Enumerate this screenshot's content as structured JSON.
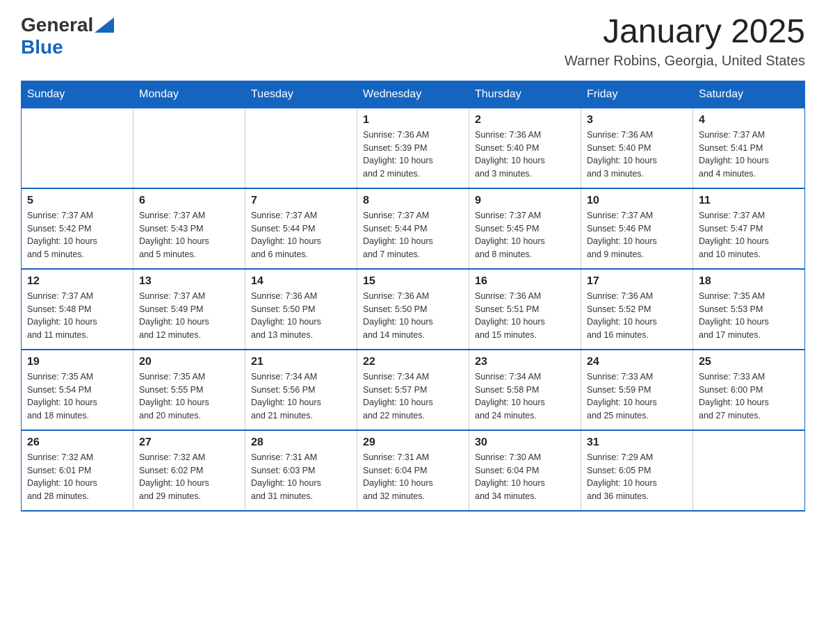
{
  "header": {
    "logo_general": "General",
    "logo_blue": "Blue",
    "month_title": "January 2025",
    "location": "Warner Robins, Georgia, United States"
  },
  "days_of_week": [
    "Sunday",
    "Monday",
    "Tuesday",
    "Wednesday",
    "Thursday",
    "Friday",
    "Saturday"
  ],
  "weeks": [
    [
      {
        "day": "",
        "info": ""
      },
      {
        "day": "",
        "info": ""
      },
      {
        "day": "",
        "info": ""
      },
      {
        "day": "1",
        "info": "Sunrise: 7:36 AM\nSunset: 5:39 PM\nDaylight: 10 hours\nand 2 minutes."
      },
      {
        "day": "2",
        "info": "Sunrise: 7:36 AM\nSunset: 5:40 PM\nDaylight: 10 hours\nand 3 minutes."
      },
      {
        "day": "3",
        "info": "Sunrise: 7:36 AM\nSunset: 5:40 PM\nDaylight: 10 hours\nand 3 minutes."
      },
      {
        "day": "4",
        "info": "Sunrise: 7:37 AM\nSunset: 5:41 PM\nDaylight: 10 hours\nand 4 minutes."
      }
    ],
    [
      {
        "day": "5",
        "info": "Sunrise: 7:37 AM\nSunset: 5:42 PM\nDaylight: 10 hours\nand 5 minutes."
      },
      {
        "day": "6",
        "info": "Sunrise: 7:37 AM\nSunset: 5:43 PM\nDaylight: 10 hours\nand 5 minutes."
      },
      {
        "day": "7",
        "info": "Sunrise: 7:37 AM\nSunset: 5:44 PM\nDaylight: 10 hours\nand 6 minutes."
      },
      {
        "day": "8",
        "info": "Sunrise: 7:37 AM\nSunset: 5:44 PM\nDaylight: 10 hours\nand 7 minutes."
      },
      {
        "day": "9",
        "info": "Sunrise: 7:37 AM\nSunset: 5:45 PM\nDaylight: 10 hours\nand 8 minutes."
      },
      {
        "day": "10",
        "info": "Sunrise: 7:37 AM\nSunset: 5:46 PM\nDaylight: 10 hours\nand 9 minutes."
      },
      {
        "day": "11",
        "info": "Sunrise: 7:37 AM\nSunset: 5:47 PM\nDaylight: 10 hours\nand 10 minutes."
      }
    ],
    [
      {
        "day": "12",
        "info": "Sunrise: 7:37 AM\nSunset: 5:48 PM\nDaylight: 10 hours\nand 11 minutes."
      },
      {
        "day": "13",
        "info": "Sunrise: 7:37 AM\nSunset: 5:49 PM\nDaylight: 10 hours\nand 12 minutes."
      },
      {
        "day": "14",
        "info": "Sunrise: 7:36 AM\nSunset: 5:50 PM\nDaylight: 10 hours\nand 13 minutes."
      },
      {
        "day": "15",
        "info": "Sunrise: 7:36 AM\nSunset: 5:50 PM\nDaylight: 10 hours\nand 14 minutes."
      },
      {
        "day": "16",
        "info": "Sunrise: 7:36 AM\nSunset: 5:51 PM\nDaylight: 10 hours\nand 15 minutes."
      },
      {
        "day": "17",
        "info": "Sunrise: 7:36 AM\nSunset: 5:52 PM\nDaylight: 10 hours\nand 16 minutes."
      },
      {
        "day": "18",
        "info": "Sunrise: 7:35 AM\nSunset: 5:53 PM\nDaylight: 10 hours\nand 17 minutes."
      }
    ],
    [
      {
        "day": "19",
        "info": "Sunrise: 7:35 AM\nSunset: 5:54 PM\nDaylight: 10 hours\nand 18 minutes."
      },
      {
        "day": "20",
        "info": "Sunrise: 7:35 AM\nSunset: 5:55 PM\nDaylight: 10 hours\nand 20 minutes."
      },
      {
        "day": "21",
        "info": "Sunrise: 7:34 AM\nSunset: 5:56 PM\nDaylight: 10 hours\nand 21 minutes."
      },
      {
        "day": "22",
        "info": "Sunrise: 7:34 AM\nSunset: 5:57 PM\nDaylight: 10 hours\nand 22 minutes."
      },
      {
        "day": "23",
        "info": "Sunrise: 7:34 AM\nSunset: 5:58 PM\nDaylight: 10 hours\nand 24 minutes."
      },
      {
        "day": "24",
        "info": "Sunrise: 7:33 AM\nSunset: 5:59 PM\nDaylight: 10 hours\nand 25 minutes."
      },
      {
        "day": "25",
        "info": "Sunrise: 7:33 AM\nSunset: 6:00 PM\nDaylight: 10 hours\nand 27 minutes."
      }
    ],
    [
      {
        "day": "26",
        "info": "Sunrise: 7:32 AM\nSunset: 6:01 PM\nDaylight: 10 hours\nand 28 minutes."
      },
      {
        "day": "27",
        "info": "Sunrise: 7:32 AM\nSunset: 6:02 PM\nDaylight: 10 hours\nand 29 minutes."
      },
      {
        "day": "28",
        "info": "Sunrise: 7:31 AM\nSunset: 6:03 PM\nDaylight: 10 hours\nand 31 minutes."
      },
      {
        "day": "29",
        "info": "Sunrise: 7:31 AM\nSunset: 6:04 PM\nDaylight: 10 hours\nand 32 minutes."
      },
      {
        "day": "30",
        "info": "Sunrise: 7:30 AM\nSunset: 6:04 PM\nDaylight: 10 hours\nand 34 minutes."
      },
      {
        "day": "31",
        "info": "Sunrise: 7:29 AM\nSunset: 6:05 PM\nDaylight: 10 hours\nand 36 minutes."
      },
      {
        "day": "",
        "info": ""
      }
    ]
  ]
}
